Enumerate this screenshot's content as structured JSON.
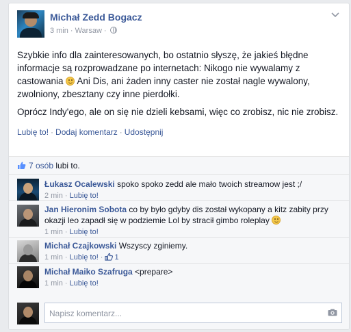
{
  "post": {
    "author": "Michał Zedd Bogacz",
    "time": "3 min",
    "separator": "·",
    "location": "Warsaw",
    "paragraph1_a": "Szybkie info dla zainteresowanych, bo ostatnio słyszę, że jakieś błędne informacje są rozprowadzane po internetach: Nikogo nie wywalamy z castowania",
    "paragraph1_b": "Ani Dis, ani żaden inny caster nie został nagle wywalony, zwolniony, zbesztany czy inne pierdołki.",
    "paragraph2": "Oprócz Indy'ego, ale on się nie dzieli kebsami, więc co zrobisz, nic nie zrobisz."
  },
  "actions": {
    "like": "Lubię to!",
    "comment": "Dodaj komentarz",
    "share": "Udostępnij",
    "dot": "·"
  },
  "likes": {
    "count_link": "7 osób",
    "suffix": "lubi to."
  },
  "comments": [
    {
      "name": "Łukasz Ocalewski",
      "text": "spoko spoko zedd ale mało twoich streamow jest ;/",
      "time": "2 min",
      "like": "Lubię to!",
      "likes": ""
    },
    {
      "name": "Jan Hieronim Sobota",
      "text": "co by było gdyby dis został wykopany a kitz zabity przy okazji leo zapadł się w podziemie Lol by stracił gimbo roleplay",
      "time": "1 min",
      "like": "Lubię to!",
      "likes": ""
    },
    {
      "name": "Michał Czajkowski",
      "text": "Wszyscy zginiemy.",
      "time": "1 min",
      "like": "Lubię to!",
      "likes": "1"
    },
    {
      "name": "Michał Maiko Szafruga",
      "text": "<prepare>",
      "time": "1 min",
      "like": "Lubię to!",
      "likes": ""
    }
  ],
  "composer": {
    "placeholder": "Napisz komentarz..."
  },
  "icons": {
    "globe": "globe-icon",
    "chevron": "chevron-down-icon",
    "thumb": "thumb-up-icon",
    "camera": "camera-icon",
    "smiley": "smiley-icon"
  },
  "colors": {
    "link": "#3b5998",
    "meta": "#9197a3",
    "feedback_bg": "#f6f7f9"
  }
}
